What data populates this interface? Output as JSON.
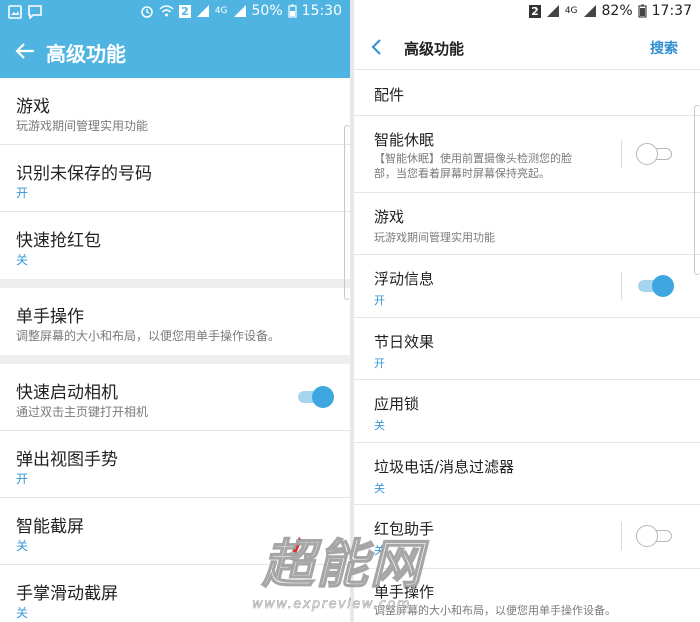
{
  "left": {
    "status": {
      "battery": "50%",
      "time": "15:30",
      "net1": "2",
      "net2": "4G"
    },
    "appbar": {
      "title": "高级功能"
    },
    "items": [
      {
        "title": "游戏",
        "subtitle": "玩游戏期间管理实用功能"
      },
      {
        "title": "识别未保存的号码",
        "value": "开"
      },
      {
        "title": "快速抢红包",
        "value": "关"
      },
      {
        "title": "单手操作",
        "subtitle": "调整屏幕的大小和布局，以便您用单手操作设备。"
      },
      {
        "title": "快速启动相机",
        "subtitle": "通过双击主页键打开相机",
        "toggle": "on"
      },
      {
        "title": "弹出视图手势",
        "value": "开"
      },
      {
        "title": "智能截屏",
        "value": "关"
      },
      {
        "title": "手掌滑动截屏",
        "value": "关"
      }
    ]
  },
  "right": {
    "status": {
      "battery": "82%",
      "time": "17:37",
      "net1": "2",
      "net2": "4G"
    },
    "appbar": {
      "title": "高级功能",
      "search_label": "搜索"
    },
    "items": [
      {
        "title": "配件"
      },
      {
        "title": "智能休眠",
        "subtitle_line1": "【智能休眠】使用前置摄像头检测您的脸",
        "subtitle_line2": "部，当您看着屏幕时屏幕保持亮起。",
        "toggle": "off"
      },
      {
        "title": "游戏",
        "subtitle": "玩游戏期间管理实用功能"
      },
      {
        "title": "浮动信息",
        "value": "开",
        "toggle": "on"
      },
      {
        "title": "节日效果",
        "value": "开"
      },
      {
        "title": "应用锁",
        "value": "关"
      },
      {
        "title": "垃圾电话/消息过滤器",
        "value": "关"
      },
      {
        "title": "红包助手",
        "value": "关",
        "toggle": "off"
      },
      {
        "title": "单手操作",
        "subtitle": "调整屏幕的大小和布局，以便您用单手操作设备。"
      }
    ]
  },
  "watermark": {
    "brand": "超能网",
    "url": "www.expreview.com"
  },
  "colors": {
    "accent": "#4fb4e2",
    "link": "#3497d4",
    "toggle_on": "#3ea7e0"
  }
}
